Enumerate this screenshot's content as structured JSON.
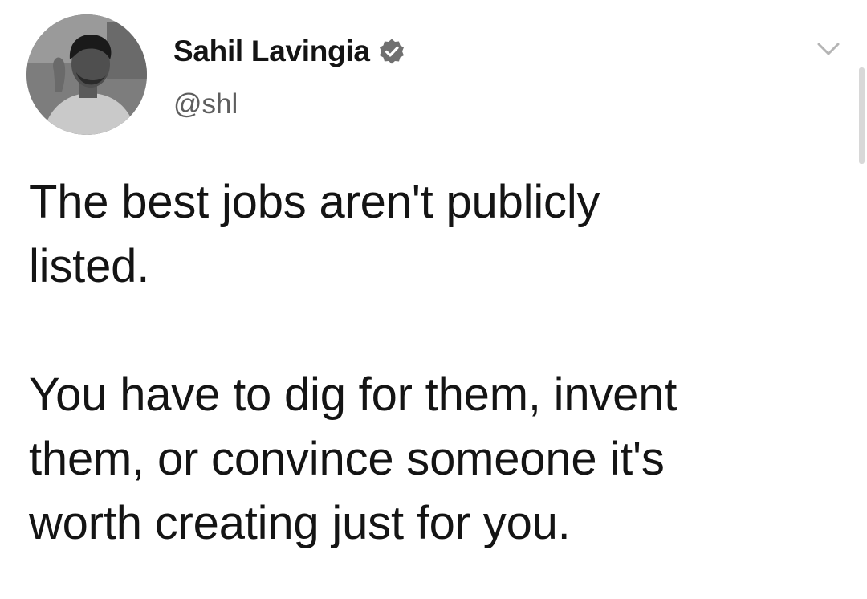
{
  "tweet": {
    "author": {
      "display_name": "Sahil Lavingia",
      "handle": "@shl",
      "verified": true,
      "avatar_icon": "profile-photo"
    },
    "paragraphs": [
      "The best jobs aren't publicly\nlisted.",
      "You have to dig for them, invent\nthem, or convince someone it's\nworth creating just for you."
    ],
    "menu_icon": "chevron-down-icon"
  },
  "colors": {
    "text": "#141414",
    "handle": "#5e5e5e",
    "verified_badge": "#707070",
    "caret": "#b5b5b5",
    "background": "#ffffff"
  }
}
